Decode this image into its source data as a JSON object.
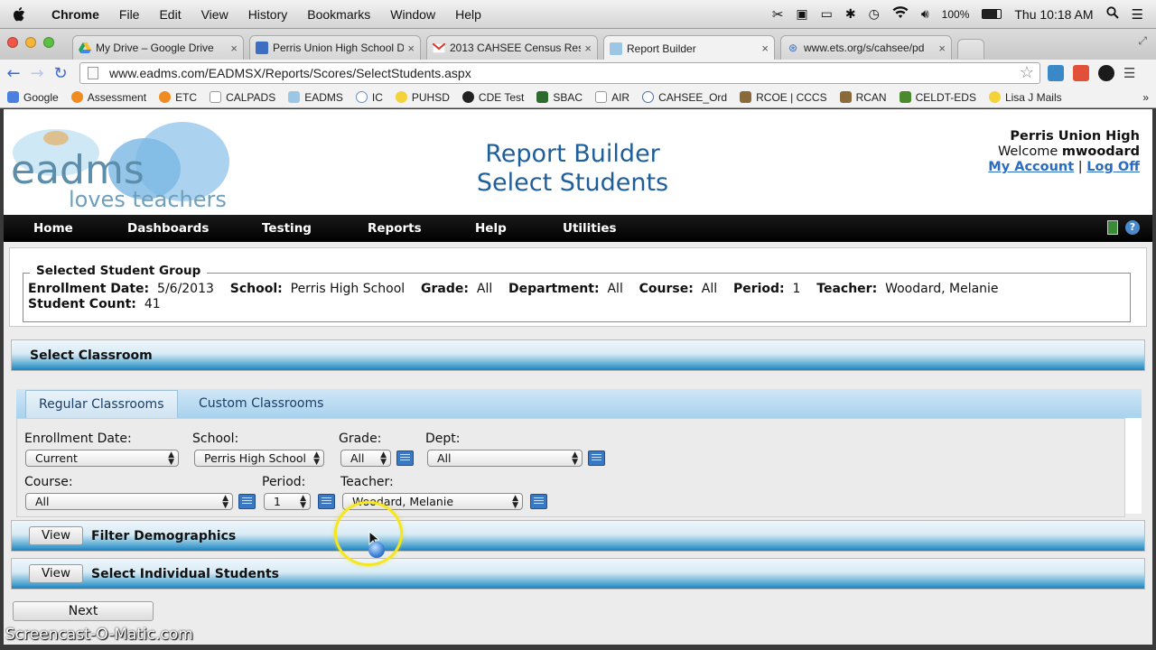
{
  "mac_menubar": {
    "app": "Chrome",
    "menus": [
      "File",
      "Edit",
      "View",
      "History",
      "Bookmarks",
      "Window",
      "Help"
    ],
    "battery": "100%",
    "clock": "Thu 10:18 AM"
  },
  "tabs": [
    {
      "title": "My Drive – Google Drive",
      "favicon": "google-drive-icon"
    },
    {
      "title": "Perris Union High School D",
      "favicon": "site-icon"
    },
    {
      "title": "2013 CAHSEE Census Res",
      "favicon": "gmail-icon"
    },
    {
      "title": "Report Builder",
      "favicon": "eadms-icon"
    },
    {
      "title": "www.ets.org/s/cahsee/pd",
      "favicon": "globe-icon"
    }
  ],
  "address_bar": {
    "url": "www.eadms.com/EADMSX/Reports/Scores/SelectStudents.aspx"
  },
  "bookmarks": [
    "Google",
    "Assessment",
    "ETC",
    "CALPADS",
    "EADMS",
    "IC",
    "PUHSD",
    "CDE Test",
    "SBAC",
    "AIR",
    "CAHSEE_Ord",
    "RCOE | CCCS",
    "RCAN",
    "CELDT-EDS",
    "Lisa J Mails"
  ],
  "header": {
    "logo_text_main": "eadms",
    "logo_text_sub": "loves teachers",
    "title_line1": "Report Builder",
    "title_line2": "Select Students",
    "school": "Perris Union High",
    "welcome_prefix": "Welcome ",
    "username": "mwoodard",
    "my_account": "My Account",
    "separator": "|",
    "log_off": "Log Off"
  },
  "nav": [
    "Home",
    "Dashboards",
    "Testing",
    "Reports",
    "Help",
    "Utilities"
  ],
  "selected_group": {
    "legend": "Selected Student Group",
    "enrollment_date_label": "Enrollment Date:",
    "enrollment_date": "5/6/2013",
    "school_label": "School:",
    "school": "Perris High School",
    "grade_label": "Grade:",
    "grade": "All",
    "department_label": "Department:",
    "department": "All",
    "course_label": "Course:",
    "course": "All",
    "period_label": "Period:",
    "period": "1",
    "teacher_label": "Teacher:",
    "teacher": "Woodard, Melanie",
    "count_label": "Student Count:",
    "count": "41"
  },
  "select_classroom": {
    "title": "Select Classroom",
    "tabs": [
      "Regular Classrooms",
      "Custom Classrooms"
    ],
    "filters": {
      "enrollment_date": {
        "label": "Enrollment Date:",
        "value": "Current"
      },
      "school": {
        "label": "School:",
        "value": "Perris High School"
      },
      "grade": {
        "label": "Grade:",
        "value": "All"
      },
      "dept": {
        "label": "Dept:",
        "value": "All"
      },
      "course": {
        "label": "Course:",
        "value": "All"
      },
      "period": {
        "label": "Period:",
        "value": "1"
      },
      "teacher": {
        "label": "Teacher:",
        "value": "Woodard, Melanie"
      }
    }
  },
  "filter_demographics": {
    "button": "View",
    "title": "Filter Demographics"
  },
  "select_individual": {
    "button": "View",
    "title": "Select Individual Students"
  },
  "next_button": "Next",
  "watermark": "Screencast-O-Matic.com",
  "colors": {
    "brand_blue": "#1e5e9a",
    "link_blue": "#2a6cc4",
    "section_blue": "#1c84c2",
    "nav_black": "#000000"
  }
}
